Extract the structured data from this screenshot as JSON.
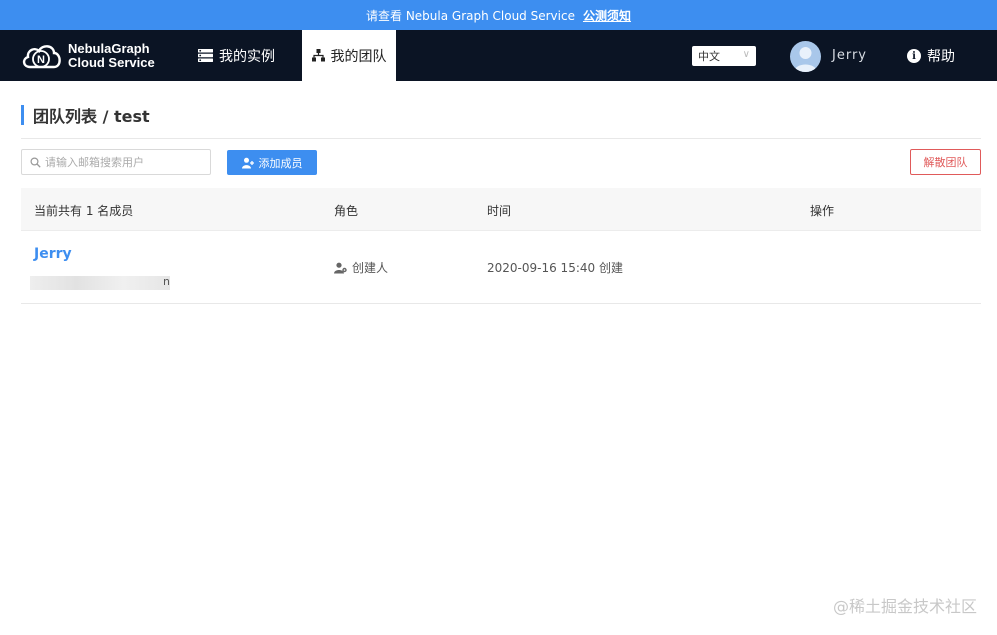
{
  "announcement": {
    "text": "请查看 Nebula Graph Cloud Service",
    "link": "公测须知"
  },
  "header": {
    "logo_line1": "NebulaGraph",
    "logo_line2": "Cloud Service",
    "nav": {
      "instances": "我的实例",
      "team": "我的团队"
    },
    "language": "中文",
    "username": "Jerry",
    "help": "帮助"
  },
  "page": {
    "title": "团队列表 / test"
  },
  "toolbar": {
    "search_placeholder": "请输入邮箱搜索用户",
    "add_member": "添加成员",
    "dissolve_team": "解散团队"
  },
  "table": {
    "headers": [
      "当前共有 1 名成员",
      "角色",
      "时间",
      "操作"
    ],
    "rows": [
      {
        "name": "Jerry",
        "email_tail": "n",
        "role": "创建人",
        "time": "2020-09-16 15:40 创建"
      }
    ]
  },
  "watermark": "@稀土掘金技术社区",
  "colors": {
    "accent": "#3d8ef0",
    "header_bg": "#0b1424",
    "danger": "#e05a5a"
  }
}
